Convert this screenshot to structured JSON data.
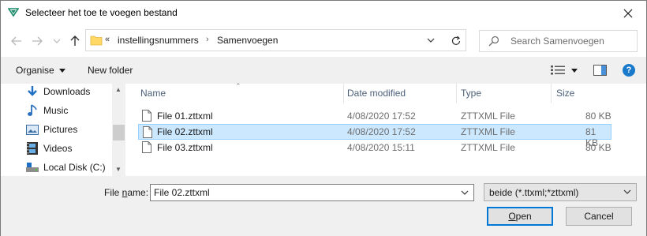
{
  "window": {
    "title": "Selecteer het toe te voegen bestand",
    "accent": "#1979ca"
  },
  "navigation": {
    "breadcrumb_chevron": "«",
    "crumbs": [
      "instellingsnummers",
      "Samenvoegen"
    ],
    "search_placeholder": "Search Samenvoegen"
  },
  "toolbar": {
    "organise_label": "Organise",
    "new_folder_label": "New folder",
    "help_label": "?"
  },
  "sidebar": {
    "items": [
      {
        "label": "Downloads",
        "icon": "download-icon"
      },
      {
        "label": "Music",
        "icon": "music-icon"
      },
      {
        "label": "Pictures",
        "icon": "pictures-icon"
      },
      {
        "label": "Videos",
        "icon": "videos-icon"
      },
      {
        "label": "Local Disk (C:)",
        "icon": "drive-icon"
      }
    ]
  },
  "filelist": {
    "columns": {
      "name": "Name",
      "date": "Date modified",
      "type": "Type",
      "size": "Size"
    },
    "rows": [
      {
        "name": "File 01.zttxml",
        "date": "4/08/2020 17:52",
        "type": "ZTTXML File",
        "size": "80 KB",
        "selected": false
      },
      {
        "name": "File 02.zttxml",
        "date": "4/08/2020 17:52",
        "type": "ZTTXML File",
        "size": "81 KB",
        "selected": true
      },
      {
        "name": "File 03.zttxml",
        "date": "4/08/2020 15:11",
        "type": "ZTTXML File",
        "size": "80 KB",
        "selected": false
      }
    ]
  },
  "footer": {
    "filename_label_pre": "File ",
    "filename_label_underline": "n",
    "filename_label_post": "ame:",
    "filename_value": "File 02.zttxml",
    "filetype_value": "beide (*.ttxml;*zttxml)",
    "open_label_underline": "O",
    "open_label_rest": "pen",
    "cancel_label": "Cancel"
  }
}
